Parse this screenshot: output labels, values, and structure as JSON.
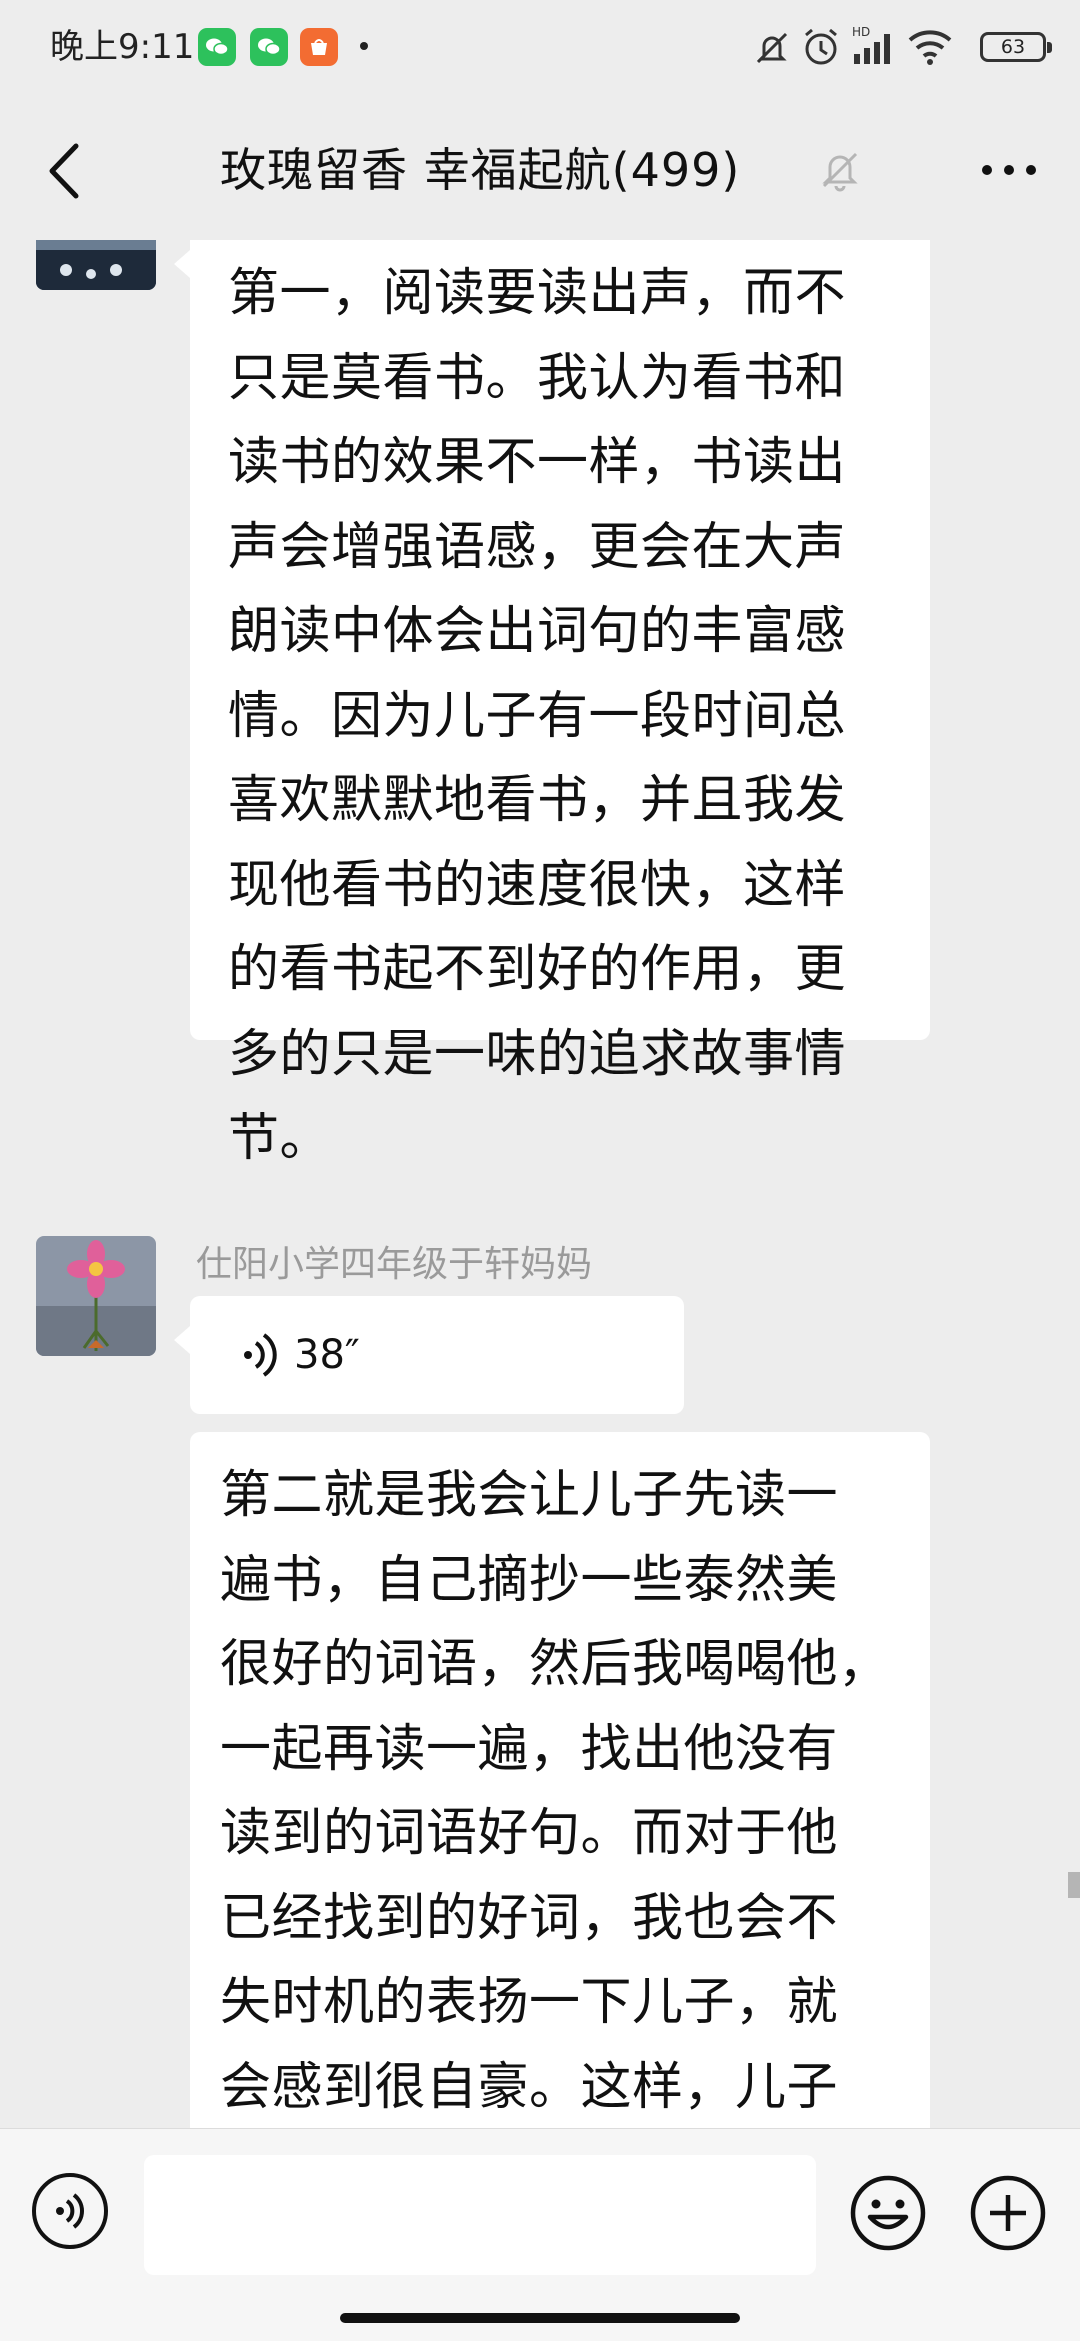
{
  "status_bar": {
    "time": "晚上9:11",
    "battery": "63",
    "icons": [
      "wechat-icon",
      "wechat-icon",
      "store-icon",
      "mute-bell-icon",
      "alarm-icon",
      "hd-signal-icon",
      "wifi-icon",
      "battery-icon"
    ]
  },
  "header": {
    "title": "玫瑰留香  幸福起航(499)",
    "icons": [
      "back-icon",
      "mute-icon",
      "more-icon"
    ]
  },
  "messages": [
    {
      "type": "text",
      "lines": [
        "第一，阅读要读出声，而不",
        "只是莫看书。我认为看书和",
        "读书的效果不一样，书读出",
        "声会增强语感，更会在大声",
        "朗读中体会出词句的丰富感",
        "情。因为儿子有一段时间总",
        "喜欢默默地看书，并且我发",
        "现他看书的速度很快，这样",
        "的看书起不到好的作用，更",
        "多的只是一味的追求故事情",
        "节。"
      ]
    },
    {
      "type": "voice",
      "sender": "仕阳小学四年级于轩妈妈",
      "duration": "38″"
    },
    {
      "type": "text",
      "lines": [
        "第二就是我会让儿子先读一",
        "遍书，自己摘抄一些泰然美",
        "很好的词语，然后我喝喝他，",
        "一起再读一遍，找出他没有",
        "读到的词语好句。而对于他",
        "已经找到的好词，我也会不",
        "失时机的表扬一下儿子，就",
        "会感到很自豪。这样，儿子"
      ]
    }
  ],
  "input_bar": {
    "value": "",
    "icons": [
      "voice-icon",
      "emoji-icon",
      "plus-icon"
    ]
  }
}
